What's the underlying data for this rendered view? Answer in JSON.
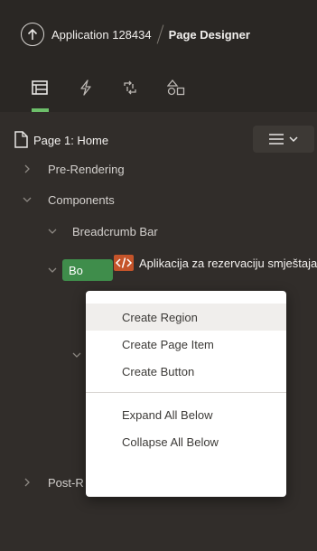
{
  "header": {
    "app_name": "Application 128434",
    "title": "Page Designer"
  },
  "toolbar": {
    "tabs": [
      {
        "name": "rendering-tab-icon",
        "active": true
      },
      {
        "name": "dynamic-actions-tab-icon",
        "active": false
      },
      {
        "name": "processing-tab-icon",
        "active": false
      },
      {
        "name": "shared-components-tab-icon",
        "active": false
      }
    ],
    "accent": "#6dbf6a"
  },
  "tree": {
    "page_title": "Page 1: Home",
    "items": [
      {
        "label": "Pre-Rendering"
      },
      {
        "label": "Components"
      },
      {
        "label": "Breadcrumb Bar"
      },
      {
        "label": "Aplikacija za rezervaciju smještaja"
      },
      {
        "label": "Bo"
      },
      {
        "label": "Post-R"
      }
    ]
  },
  "context_menu": {
    "items": [
      {
        "label": "Create Region"
      },
      {
        "label": "Create Page Item"
      },
      {
        "label": "Create Button"
      },
      {
        "label": "Expand All Below"
      },
      {
        "label": "Collapse All Below"
      }
    ]
  },
  "colors": {
    "background": "#312d2a",
    "header": "#2a2724",
    "body_badge": "#3f8d4b",
    "code_icon": "#e06a3a"
  }
}
